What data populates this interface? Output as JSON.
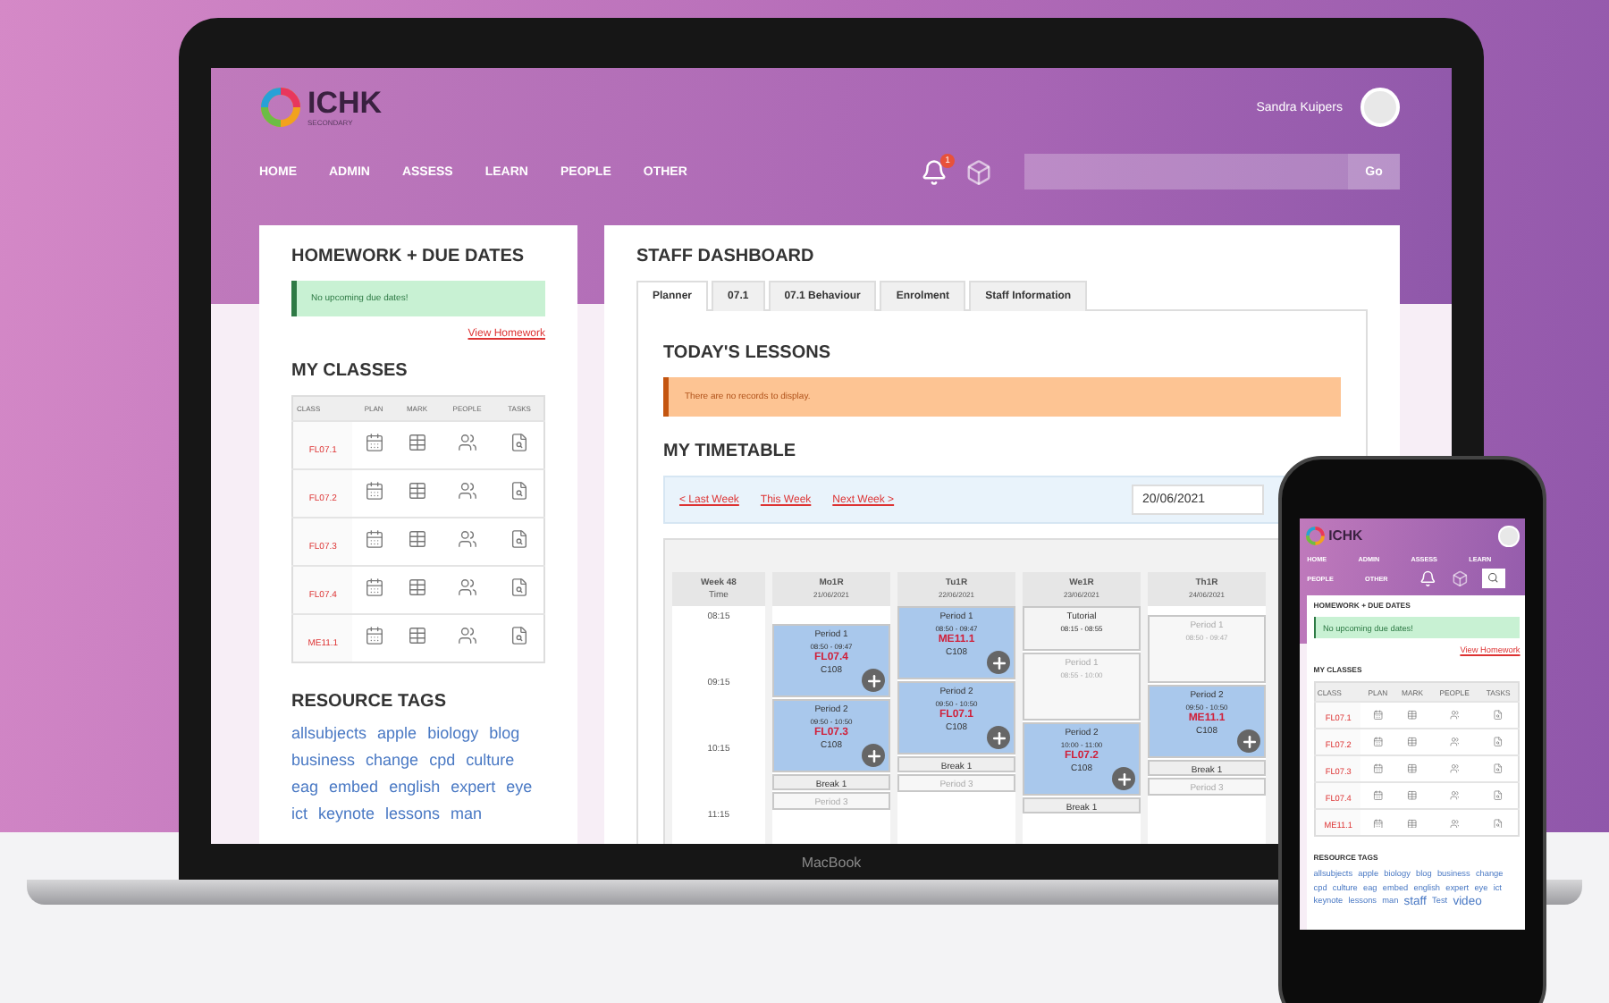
{
  "laptop": {
    "header": {
      "logo_text": "ICHK",
      "logo_subtext": "SECONDARY",
      "user_name": "Sandra Kuipers",
      "notification_count": "1",
      "search_button": "Go"
    },
    "nav": [
      "HOME",
      "ADMIN",
      "ASSESS",
      "LEARN",
      "PEOPLE",
      "OTHER"
    ],
    "homework": {
      "title": "HOMEWORK + DUE DATES",
      "message": "No upcoming due dates!",
      "link": "View Homework"
    },
    "classes": {
      "title": "MY CLASSES",
      "columns": [
        "CLASS",
        "PLAN",
        "MARK",
        "PEOPLE",
        "TASKS"
      ],
      "rows": [
        "FL07.1",
        "FL07.2",
        "FL07.3",
        "FL07.4",
        "ME11.1"
      ]
    },
    "tags": {
      "title": "RESOURCE TAGS",
      "items": [
        {
          "label": "allsubjects",
          "large": false
        },
        {
          "label": "apple",
          "large": false
        },
        {
          "label": "biology",
          "large": false
        },
        {
          "label": "blog",
          "large": false
        },
        {
          "label": "business",
          "large": false
        },
        {
          "label": "change",
          "large": false
        },
        {
          "label": "cpd",
          "large": false
        },
        {
          "label": "culture",
          "large": false
        },
        {
          "label": "eag",
          "large": false
        },
        {
          "label": "embed",
          "large": false
        },
        {
          "label": "english",
          "large": false
        },
        {
          "label": "expert",
          "large": false
        },
        {
          "label": "eye",
          "large": false
        },
        {
          "label": "ict",
          "large": false
        },
        {
          "label": "keynote",
          "large": false
        },
        {
          "label": "lessons",
          "large": false
        },
        {
          "label": "man",
          "large": false
        }
      ]
    },
    "dashboard": {
      "title": "STAFF DASHBOARD",
      "tabs": [
        {
          "label": "Planner",
          "selected": true
        },
        {
          "label": "07.1",
          "selected": false
        },
        {
          "label": "07.1 Behaviour",
          "selected": false
        },
        {
          "label": "Enrolment",
          "selected": false
        },
        {
          "label": "Staff Information",
          "selected": false
        }
      ],
      "lessons_title": "TODAY'S LESSONS",
      "lessons_message": "There are no records to display.",
      "timetable_title": "MY TIMETABLE",
      "week_links": [
        "< Last Week",
        "This Week",
        "Next Week >"
      ],
      "date": "20/06/2021",
      "timetable": {
        "week": "Week 48",
        "time_label": "Time",
        "times": [
          "08:15",
          "09:15",
          "10:15",
          "11:15"
        ],
        "days": [
          {
            "name": "Mo1R",
            "date": "21/06/2021",
            "entries": [
              {
                "kind": "lesson",
                "title": "Period 1",
                "time": "08:50 - 09:47",
                "class": "FL07.4",
                "room": "C108"
              },
              {
                "kind": "lesson",
                "title": "Period 2",
                "time": "09:50 - 10:50",
                "class": "FL07.3",
                "room": "C108"
              },
              {
                "kind": "break",
                "title": "Break 1"
              },
              {
                "kind": "free",
                "title": "Period 3"
              }
            ]
          },
          {
            "name": "Tu1R",
            "date": "22/06/2021",
            "entries": [
              {
                "kind": "lesson",
                "title": "Period 1",
                "time": "08:50 - 09:47",
                "class": "ME11.1",
                "room": "C108"
              },
              {
                "kind": "lesson",
                "title": "Period 2",
                "time": "09:50 - 10:50",
                "class": "FL07.1",
                "room": "C108"
              },
              {
                "kind": "break",
                "title": "Break 1"
              },
              {
                "kind": "free",
                "title": "Period 3"
              }
            ]
          },
          {
            "name": "We1R",
            "date": "23/06/2021",
            "entries": [
              {
                "kind": "tutorial",
                "title": "Tutorial",
                "time": "08:15 - 08:55"
              },
              {
                "kind": "free",
                "title": "Period 1",
                "time": "08:55 - 10:00"
              },
              {
                "kind": "lesson",
                "title": "Period 2",
                "time": "10:00 - 11:00",
                "class": "FL07.2",
                "room": "C108"
              },
              {
                "kind": "break",
                "title": "Break 1"
              }
            ]
          },
          {
            "name": "Th1R",
            "date": "24/06/2021",
            "entries": [
              {
                "kind": "free",
                "title": "Period 1",
                "time": "08:50 - 09:47"
              },
              {
                "kind": "lesson",
                "title": "Period 2",
                "time": "09:50 - 10:50",
                "class": "ME11.1",
                "room": "C108"
              },
              {
                "kind": "break",
                "title": "Break 1"
              },
              {
                "kind": "free",
                "title": "Period 3"
              }
            ]
          }
        ]
      }
    },
    "brand": "MacBook"
  },
  "phone": {
    "header": {
      "logo_text": "ICHK",
      "nav": [
        "HOME",
        "ADMIN",
        "ASSESS",
        "LEARN",
        "PEOPLE",
        "OTHER"
      ]
    },
    "homework": {
      "title": "HOMEWORK + DUE DATES",
      "message": "No upcoming due dates!",
      "link": "View Homework"
    },
    "classes": {
      "title": "MY CLASSES",
      "columns": [
        "CLASS",
        "PLAN",
        "MARK",
        "PEOPLE",
        "TASKS"
      ],
      "rows": [
        "FL07.1",
        "FL07.2",
        "FL07.3",
        "FL07.4",
        "ME11.1"
      ]
    },
    "tags": {
      "title": "RESOURCE TAGS",
      "items": [
        {
          "label": "allsubjects",
          "large": false
        },
        {
          "label": "apple",
          "large": false
        },
        {
          "label": "biology",
          "large": false
        },
        {
          "label": "blog",
          "large": false
        },
        {
          "label": "business",
          "large": false
        },
        {
          "label": "change",
          "large": false
        },
        {
          "label": "cpd",
          "large": false
        },
        {
          "label": "culture",
          "large": false
        },
        {
          "label": "eag",
          "large": false
        },
        {
          "label": "embed",
          "large": false
        },
        {
          "label": "english",
          "large": false
        },
        {
          "label": "expert",
          "large": false
        },
        {
          "label": "eye",
          "large": false
        },
        {
          "label": "ict",
          "large": false
        },
        {
          "label": "keynote",
          "large": false
        },
        {
          "label": "lessons",
          "large": false
        },
        {
          "label": "man",
          "large": false
        },
        {
          "label": "staff",
          "large": true
        },
        {
          "label": "Test",
          "large": false
        },
        {
          "label": "video",
          "large": true
        }
      ]
    }
  }
}
